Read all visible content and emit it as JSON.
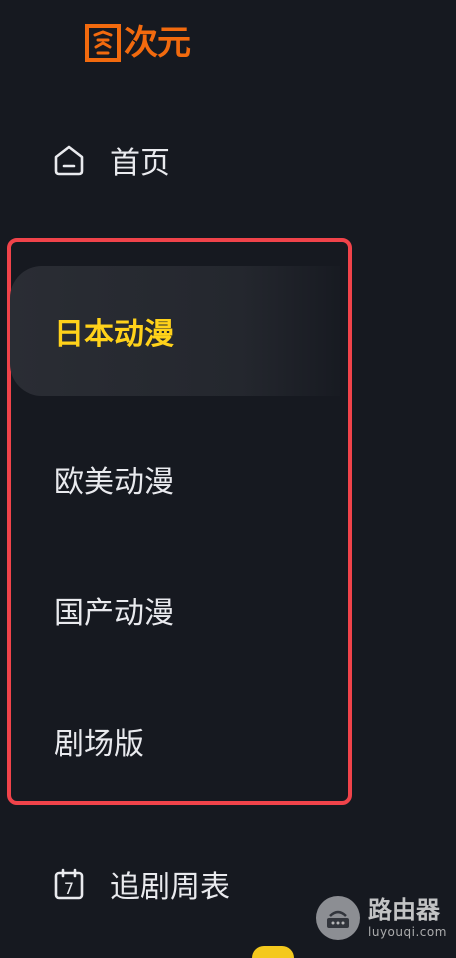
{
  "logo": {
    "text": "次元",
    "brand_color": "#f26a0e"
  },
  "nav": {
    "home_label": "首页",
    "schedule_label": "追剧周表",
    "schedule_icon_number": "7"
  },
  "categories": {
    "items": [
      {
        "label": "日本动漫",
        "active": true
      },
      {
        "label": "欧美动漫",
        "active": false
      },
      {
        "label": "国产动漫",
        "active": false
      },
      {
        "label": "剧场版",
        "active": false
      }
    ],
    "highlight_border_color": "#f0434a",
    "active_text_color": "#ffd21a"
  },
  "watermark": {
    "title": "路由器",
    "subtitle": "luyouqi.com"
  },
  "colors": {
    "background": "#161920",
    "text": "#e9eaee"
  }
}
